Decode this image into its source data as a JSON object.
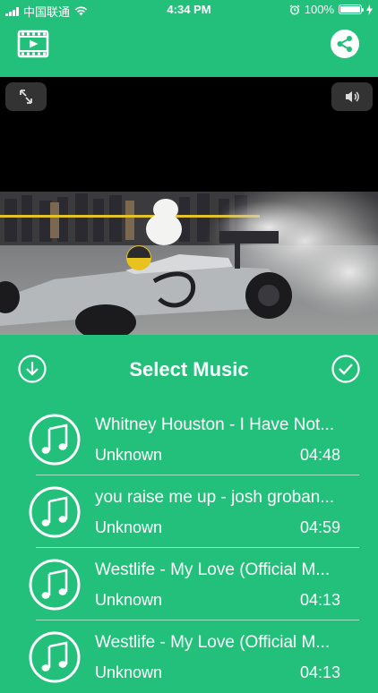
{
  "status_bar": {
    "carrier": "中国联通",
    "time": "4:34 PM",
    "battery_text": "100%",
    "battery_level": 1.0
  },
  "nav": {
    "left_icon": "film-icon",
    "right_icon": "share-icon"
  },
  "video": {
    "expand_icon": "expand-icon",
    "volume_icon": "volume-icon"
  },
  "music": {
    "title": "Select Music",
    "left_icon": "download-circle-icon",
    "right_icon": "check-circle-icon",
    "songs": [
      {
        "title": "Whitney Houston - I Have Not...",
        "artist": "Unknown",
        "duration": "04:48"
      },
      {
        "title": "you raise me up - josh groban...",
        "artist": "Unknown",
        "duration": "04:59"
      },
      {
        "title": "Westlife - My Love (Official M...",
        "artist": "Unknown",
        "duration": "04:13"
      },
      {
        "title": "Westlife - My Love (Official M...",
        "artist": "Unknown",
        "duration": "04:13"
      }
    ]
  },
  "colors": {
    "accent": "#22c07a",
    "video_background": "#000000"
  }
}
